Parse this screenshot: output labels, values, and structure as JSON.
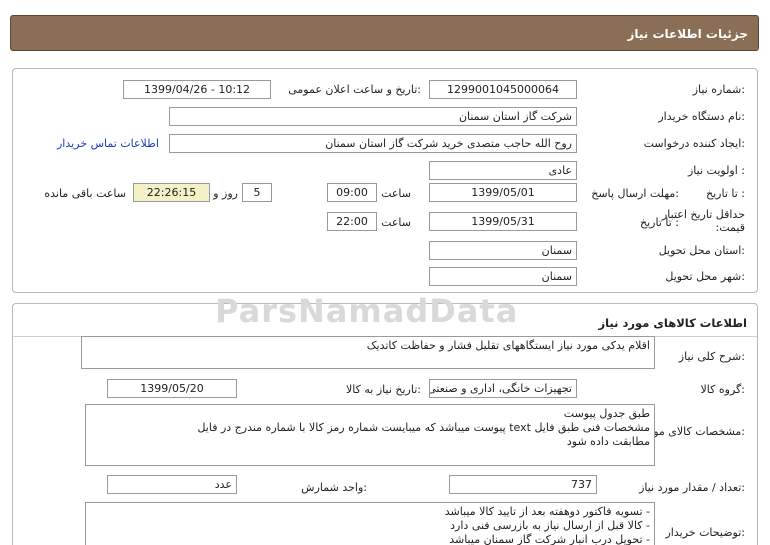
{
  "header": {
    "title": "جزئیات اطلاعات نیاز"
  },
  "watermark": "ParsNamadData",
  "info": {
    "need_number_label": "شماره نیاز:",
    "need_number": "1299001045000064",
    "announce_label": "تاریخ و ساعت اعلان عمومی:",
    "announce_value": "1399/04/26 - 10:12",
    "buyer_org_label": "نام دستگاه خریدار:",
    "buyer_org": "شرکت گاز استان سمنان",
    "creator_label": "ایجاد کننده درخواست:",
    "creator": "روح الله  حاجب متصدی خرید شرکت گاز استان سمنان",
    "contact_link": "اطلاعات تماس خریدار",
    "priority_label": "اولویت نیاز :",
    "priority": "عادی",
    "deadline_label": "مهلت ارسال پاسخ:",
    "to_date_label": "تا تاریخ :",
    "deadline_date": "1399/05/01",
    "time_label": "ساعت",
    "deadline_time": "09:00",
    "days": "5",
    "days_label": "روز و",
    "remaining_time": "22:26:15",
    "remaining_label": "ساعت باقی مانده",
    "price_validity_label": "حداقل تاریخ اعتبار قیمت:",
    "price_to_date_label": "تا تاریخ :",
    "price_date": "1399/05/31",
    "price_time_label": "ساعت",
    "price_time": "22:00",
    "province_label": "استان محل تحویل:",
    "province": "سمنان",
    "city_label": "شهر محل تحویل:",
    "city": "سمنان"
  },
  "goods": {
    "section_title": "اطلاعات کالاهای مورد نیاز",
    "desc_label": "شرح کلی نیاز:",
    "desc": "اقلام یدکی مورد نیاز ایستگاههای تقلیل فشار و حفاظت کاتدیک",
    "group_label": "گروه کالا:",
    "group": "تجهیزات خانگی، اداری و صنعتی",
    "need_date_label": "تاریخ نیاز به کالا:",
    "need_date": "1399/05/20",
    "spec_label": "مشخصات کالای مورد نیاز:",
    "spec_lines": [
      "طبق جدول پیوست",
      "مشخصات فنی طبق فایل text پیوست میباشد که میبایست شماره رمز کالا با شماره مندرج در فایل",
      "مطابقت داده شود"
    ],
    "qty_label": "تعداد / مقدار مورد نیاز:",
    "qty": "737",
    "unit_label": "واحد شمارش:",
    "unit": "عدد",
    "notes_label": "توضیحات خریدار:",
    "notes_lines": [
      "- تسویه فاکتور دوهفته بعد از تایید کالا میباشد",
      "- کالا قبل از ارسال نیاز به بازرسی فنی دارد",
      "- تحویل درب انبار شرکت گاز سمنان میباشد"
    ]
  }
}
